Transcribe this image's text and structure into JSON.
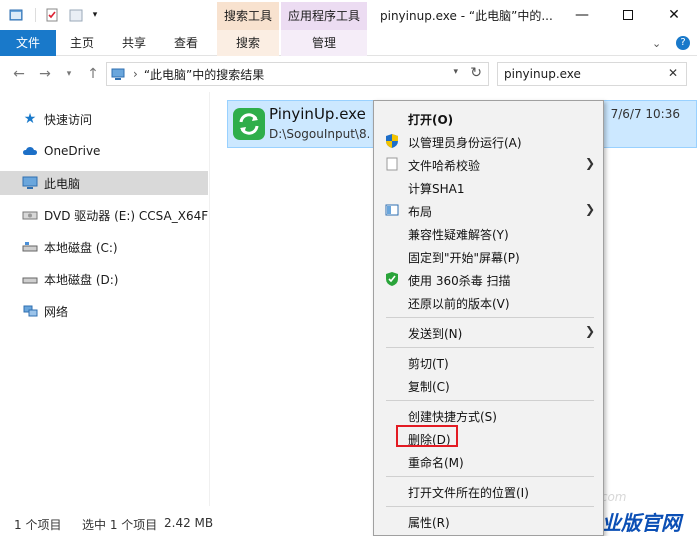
{
  "window": {
    "title": "pinyinup.exe - “此电脑”中的...",
    "context_tab_search": "搜索工具",
    "context_tab_app": "应用程序工具"
  },
  "ribbon": {
    "tabs": [
      "文件",
      "主页",
      "共享",
      "查看",
      "搜索",
      "管理"
    ]
  },
  "address": {
    "path": "“此电脑”中的搜索结果",
    "search_value": "pinyinup.exe"
  },
  "nav": {
    "items": [
      "快速访问",
      "OneDrive",
      "此电脑",
      "DVD 驱动器 (E:) CCSA_X64FR",
      "本地磁盘 (C:)",
      "本地磁盘 (D:)",
      "网络"
    ]
  },
  "result": {
    "name": "PinyinUp.exe",
    "path": "D:\\SogouInput\\8.5",
    "date": "7/6/7 10:36"
  },
  "menu": {
    "items": [
      "打开(O)",
      "以管理员身份运行(A)",
      "文件哈希校验",
      "计算SHA1",
      "布局",
      "兼容性疑难解答(Y)",
      "固定到\"开始\"屏幕(P)",
      "使用 360杀毒 扫描",
      "还原以前的版本(V)",
      "发送到(N)",
      "剪切(T)",
      "复制(C)",
      "创建快捷方式(S)",
      "删除(D)",
      "重命名(M)",
      "打开文件所在的位置(I)",
      "属性(R)"
    ]
  },
  "status": {
    "count": "1 个项目",
    "selected": "选中 1 个项目",
    "size": "2.42 MB"
  },
  "watermark": {
    "url": "win10zyb.com",
    "brand": "Win10专业版官网"
  },
  "colors": {
    "file_tab": "#1979ca",
    "selection": "#cce8ff",
    "highlight": "#e31b23"
  }
}
